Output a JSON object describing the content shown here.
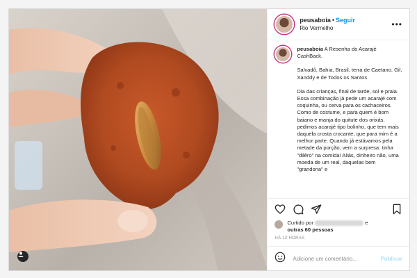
{
  "post": {
    "username": "peusaboia",
    "separator": "•",
    "follow_label": "Seguir",
    "location": "Rio Vermelho",
    "caption_paragraphs": [
      "A Resenha do Acarajé CashBack.",
      "Salvadô, Bahia, Brasil, terra de Caetano, Gil, Xanddy e de Todos os Santos.",
      "Dia das crianças, final de tarde, sol e praia. Essa combinação já pede um acarajé com coquinha, ou cerva para os cachaceiros. Como de costume, e para quem é bom baiano e manja do quitute dos orixás, pedimos acarajé tipo bolinho, que tem mais daquela crosta crocante, que para mim é a melhor parte. Quando já estávamos pela metade da porção, vem a surpresa: tinha \"dilêro\" na comida! Aliás, dinheiro não, uma moeda de um real, daquelas bem \"grandona\" e"
    ],
    "likes_prefix": "Curtido por",
    "likes_and": "e",
    "likes_others": "outras 60 pessoas",
    "time_ago": "HÁ 12 HORAS",
    "comment_placeholder": "Adicione um comentário...",
    "publish_label": "Publicar"
  },
  "icons": {
    "more": "ellipsis-icon",
    "like": "heart-icon",
    "comment": "comment-icon",
    "share": "paper-plane-icon",
    "save": "bookmark-icon",
    "emoji": "smiley-icon",
    "tagged": "user-tag-icon"
  },
  "colors": {
    "link": "#0095f6",
    "publish_disabled": "#b2dffc",
    "muted": "#8e8e8e",
    "acaraje": "#b5481f",
    "coin": "#c98a3d"
  }
}
